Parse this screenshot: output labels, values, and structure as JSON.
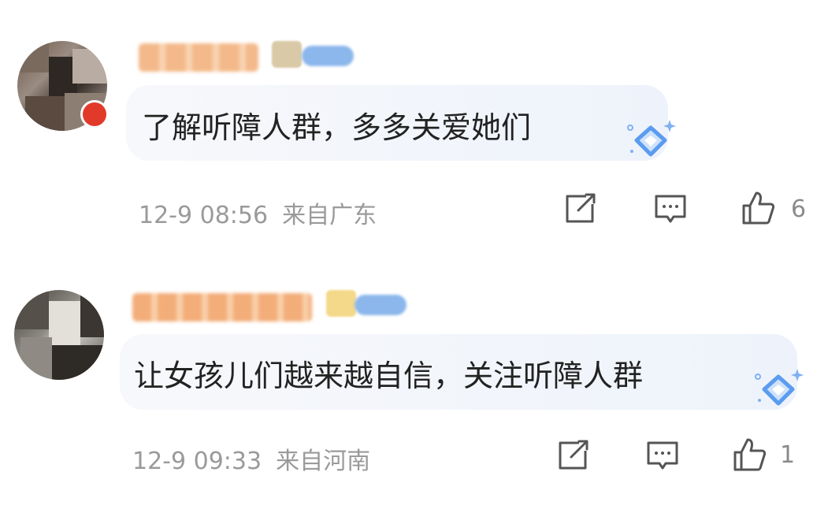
{
  "comments": [
    {
      "text": "了解听障人群，多多关爱她们",
      "time": "12-9 08:56",
      "location": "来自广东",
      "likes": "6"
    },
    {
      "text": "让女孩儿们越来越自信，关注听障人群",
      "time": "12-9 09:33",
      "location": "来自河南",
      "likes": "1"
    }
  ],
  "icons": {
    "share": "share-icon",
    "reply": "comment-icon",
    "like": "thumbs-up-icon",
    "decoration": "diamond-sticker-icon"
  },
  "colors": {
    "bubble": "#eef3fb",
    "text": "#222222",
    "meta": "#9a9a9a",
    "diamond": "#5b9cf0"
  }
}
